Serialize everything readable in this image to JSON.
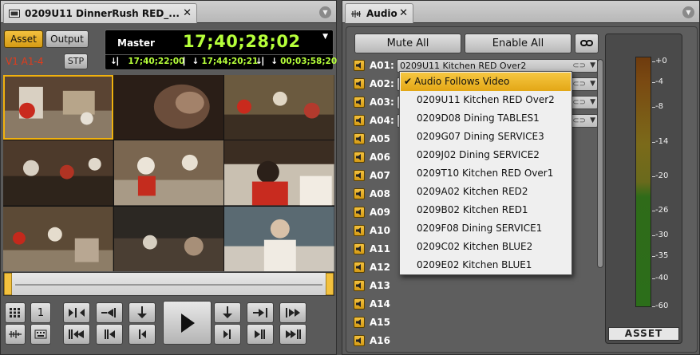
{
  "left_panel": {
    "tab_title": "0209U11 DinnerRush RED_...",
    "asset_button": "Asset",
    "output_button": "Output",
    "track_label": "V1 A1-4",
    "stp_button": "STP",
    "timecode": {
      "label": "Master",
      "main": "17;40;28;02",
      "mark_in": "17;40;22;00",
      "mark_out": "17;44;20;21",
      "duration": "00;03;58;20"
    },
    "step_button": "1"
  },
  "audio_panel": {
    "tab_title": "Audio",
    "mute_all": "Mute All",
    "enable_all": "Enable All",
    "tracks": [
      {
        "name": "A01:",
        "source": "0209U11 Kitchen RED Over2"
      },
      {
        "name": "A02:",
        "source": ""
      },
      {
        "name": "A03:",
        "source": ""
      },
      {
        "name": "A04:",
        "source": ""
      },
      {
        "name": "A05",
        "source": ""
      },
      {
        "name": "A06",
        "source": ""
      },
      {
        "name": "A07",
        "source": ""
      },
      {
        "name": "A08",
        "source": ""
      },
      {
        "name": "A09",
        "source": ""
      },
      {
        "name": "A10",
        "source": ""
      },
      {
        "name": "A11",
        "source": ""
      },
      {
        "name": "A12",
        "source": ""
      },
      {
        "name": "A13",
        "source": ""
      },
      {
        "name": "A14",
        "source": ""
      },
      {
        "name": "A15",
        "source": ""
      },
      {
        "name": "A16",
        "source": ""
      }
    ],
    "dropdown": {
      "items": [
        {
          "label": "Audio Follows Video",
          "checked": true
        },
        {
          "label": "0209U11 Kitchen RED Over2",
          "checked": false
        },
        {
          "label": "0209D08 Dining TABLES1",
          "checked": false
        },
        {
          "label": "0209G07 Dining SERVICE3",
          "checked": false
        },
        {
          "label": "0209J02 Dining SERVICE2",
          "checked": false
        },
        {
          "label": "0209T10 Kitchen RED Over1",
          "checked": false
        },
        {
          "label": "0209A02 Kitchen RED2",
          "checked": false
        },
        {
          "label": "0209B02 Kitchen RED1",
          "checked": false
        },
        {
          "label": "0209F08 Dining SERVICE1",
          "checked": false
        },
        {
          "label": "0209C02 Kitchen BLUE2",
          "checked": false
        },
        {
          "label": "0209E02 Kitchen BLUE1",
          "checked": false
        }
      ]
    },
    "meter": {
      "ticks": [
        "+0",
        "-4",
        "-8",
        "-14",
        "-20",
        "-26",
        "-30",
        "-35",
        "-40",
        "-60"
      ],
      "label": "ASSET"
    }
  },
  "colors": {
    "accent_yellow": "#e8ab1a",
    "timecode_green": "#b6ff3a",
    "track_red": "#e23b1b"
  }
}
